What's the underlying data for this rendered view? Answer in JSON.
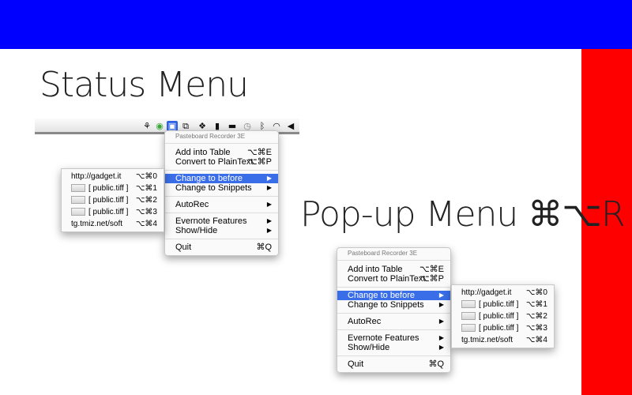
{
  "titles": {
    "status": "Status Menu",
    "popup": "Pop-up Menu ⌘⌥R"
  },
  "menubar_icons": [
    {
      "name": "evernote-icon",
      "glyph": "⚘",
      "selected": false
    },
    {
      "name": "app-green-icon",
      "glyph": "◉",
      "selected": false
    },
    {
      "name": "pasteboard-recorder-icon",
      "glyph": "▣",
      "selected": true
    },
    {
      "name": "copy-icon",
      "glyph": "⧉",
      "selected": false
    },
    {
      "name": "dropbox-icon",
      "glyph": "❖",
      "selected": false
    },
    {
      "name": "battery-icon",
      "glyph": "▮",
      "selected": false
    },
    {
      "name": "display-icon",
      "glyph": "▬",
      "selected": false
    },
    {
      "name": "time-machine-icon",
      "glyph": "◷",
      "selected": false
    },
    {
      "name": "bluetooth-icon",
      "glyph": "ᛒ",
      "selected": false
    },
    {
      "name": "wifi-icon",
      "glyph": "◠",
      "selected": false
    },
    {
      "name": "volume-icon",
      "glyph": "◀",
      "selected": false
    }
  ],
  "menu": {
    "header": "Pasteboard Recorder 3E",
    "add_table": {
      "label": "Add into Table",
      "shortcut": "⌥⌘E"
    },
    "convert": {
      "label": "Convert to PlainText",
      "shortcut": "⌥⌘P"
    },
    "change_before": {
      "label": "Change to before",
      "arrow": "▶"
    },
    "change_snippets": {
      "label": "Change to Snippets",
      "arrow": "▶"
    },
    "autorec": {
      "label": "AutoRec",
      "arrow": "▶"
    },
    "evernote": {
      "label": "Evernote Features",
      "arrow": "▶"
    },
    "showhide": {
      "label": "Show/Hide",
      "arrow": "▶"
    },
    "quit": {
      "label": "Quit",
      "shortcut": "⌘Q"
    }
  },
  "submenu": {
    "item0": {
      "label": "http://gadget.it",
      "shortcut": "⌥⌘0"
    },
    "item1": {
      "label": "[ public.tiff ]",
      "shortcut": "⌥⌘1"
    },
    "item2": {
      "label": "[ public.tiff ]",
      "shortcut": "⌥⌘2"
    },
    "item3": {
      "label": "[ public.tiff ]",
      "shortcut": "⌥⌘3"
    },
    "item4": {
      "label": "tg.tmiz.net/soft",
      "shortcut": "⌥⌘4"
    }
  },
  "colors": {
    "blue": "#0000ff",
    "red": "#ff0000",
    "highlight": "#3a6ee8"
  }
}
